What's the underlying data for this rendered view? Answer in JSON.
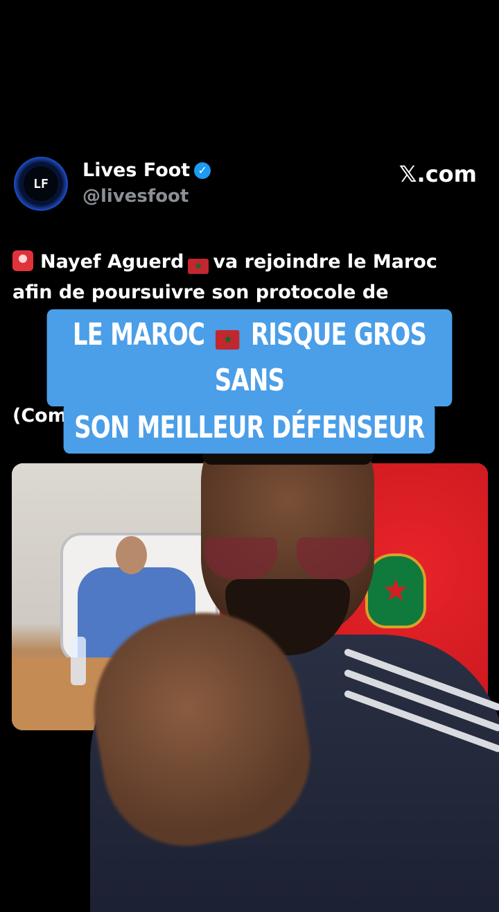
{
  "tweet": {
    "avatar_text": "LF",
    "name": "Lives Foot",
    "verified_icon": "verified-badge-icon",
    "handle": "@livesfoot",
    "source": "𝕏.com",
    "text_part1": "Nayef Aguerd",
    "text_part2": "va rejoindre le Maroc",
    "text_line2": "afin de poursuivre son protocole de",
    "signature": "(Communiqué OM)"
  },
  "overlay": {
    "line1_a": "LE MAROC",
    "line1_b": "RISQUE GROS SANS",
    "line2": "SON MEILLEUR DÉFENSEUR"
  },
  "colors": {
    "caption_bg": "#4b9ee8",
    "verified": "#1d9bf0",
    "background": "#000000"
  }
}
